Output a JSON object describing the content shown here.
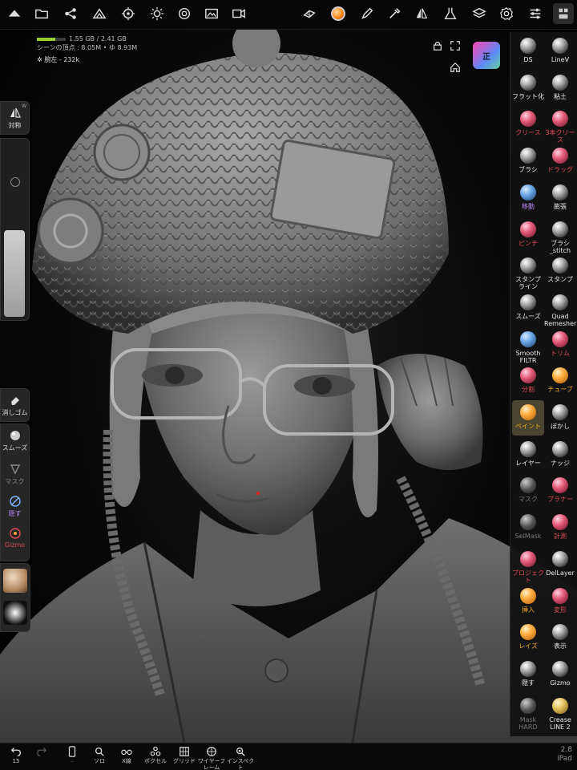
{
  "app": {
    "version": "2.8",
    "device": "iPad"
  },
  "stats": {
    "memory_label": "1.55 GB / 2.41 GB",
    "memory_fraction": 0.64,
    "vertex_label": "シーンの頂点 : 8.05M • ",
    "vertex_suffix": "ゆ 8.93M",
    "object_label": "腕左 - 232k"
  },
  "view": {
    "orientation_label": "正"
  },
  "left_panel": {
    "symmetry": {
      "label": "対称",
      "badge": "W"
    },
    "eraser": "消しゴム",
    "smooth": "スムーズ",
    "mask": "マスク",
    "hide": "隠す",
    "gizmo": "Gizmo"
  },
  "tools": [
    {
      "label": "DS",
      "style": "white",
      "icon": "ds-brush-icon"
    },
    {
      "label": "LineV",
      "style": "white",
      "icon": "linev-brush-icon"
    },
    {
      "label": "フラット化",
      "style": "white",
      "icon": "flatten-icon"
    },
    {
      "label": "粘土",
      "style": "white",
      "icon": "clay-icon"
    },
    {
      "label": "クリース",
      "style": "red",
      "icon": "crease-icon"
    },
    {
      "label": "3本クリース",
      "style": "red",
      "icon": "crease3-icon"
    },
    {
      "label": "ブラシ",
      "style": "white",
      "icon": "brush-icon"
    },
    {
      "label": "ドラッグ",
      "style": "red",
      "icon": "drag-icon"
    },
    {
      "label": "移動",
      "style": "purple",
      "icon": "move-icon"
    },
    {
      "label": "膨張",
      "style": "white",
      "icon": "inflate-icon"
    },
    {
      "label": "ピンチ",
      "style": "red",
      "icon": "pinch-icon"
    },
    {
      "label": "ブラシ_stitch",
      "style": "white",
      "icon": "stitch-brush-icon"
    },
    {
      "label": "スタンプ ライン",
      "style": "white",
      "icon": "stamp-line-icon"
    },
    {
      "label": "スタンプ",
      "style": "white",
      "icon": "stamp-icon"
    },
    {
      "label": "スムーズ",
      "style": "white",
      "icon": "smooth-icon"
    },
    {
      "label": "Quad Remesher",
      "style": "white",
      "icon": "quad-remesher-icon"
    },
    {
      "label": "Smooth FILTR",
      "style": "white",
      "icon": "smooth-filter-icon"
    },
    {
      "label": "トリム",
      "style": "red",
      "icon": "trim-icon"
    },
    {
      "label": "分割",
      "style": "red",
      "icon": "split-icon"
    },
    {
      "label": "チューブ",
      "style": "orange",
      "icon": "tube-icon"
    },
    {
      "label": "ペイント",
      "style": "orange",
      "icon": "paint-icon",
      "selected": true
    },
    {
      "label": "ぼかし",
      "style": "white",
      "icon": "blur-icon"
    },
    {
      "label": "レイヤー",
      "style": "white",
      "icon": "layer-icon"
    },
    {
      "label": "ナッジ",
      "style": "white",
      "icon": "nudge-icon"
    },
    {
      "label": "マスク",
      "style": "gray",
      "icon": "mask-icon"
    },
    {
      "label": "プラナー",
      "style": "red",
      "icon": "planar-icon"
    },
    {
      "label": "SelMask",
      "style": "gray",
      "icon": "selmask-icon"
    },
    {
      "label": "計測",
      "style": "red",
      "icon": "measure-icon"
    },
    {
      "label": "プロジェクト",
      "style": "red",
      "icon": "project-icon"
    },
    {
      "label": "DelLayer",
      "style": "white",
      "icon": "dellayer-icon"
    },
    {
      "label": "挿入",
      "style": "orange",
      "icon": "insert-icon"
    },
    {
      "label": "変形",
      "style": "red",
      "icon": "transform-icon"
    },
    {
      "label": "レイズ",
      "style": "orange",
      "icon": "raise-icon"
    },
    {
      "label": "表示",
      "style": "white",
      "icon": "camera-icon"
    },
    {
      "label": "隠す",
      "style": "white",
      "icon": "hide-icon"
    },
    {
      "label": "Gizmo",
      "style": "white",
      "icon": "gizmo-icon"
    },
    {
      "label": "Mask HARD",
      "style": "gray",
      "icon": "mask-hard-icon"
    },
    {
      "label": "Crease LINE 2",
      "style": "white",
      "icon": "crease-line2-icon"
    }
  ],
  "bottom_bar": {
    "undo_count": "15",
    "items": [
      {
        "label": "ソロ",
        "icon": "search-icon"
      },
      {
        "label": "X線",
        "icon": "xray-glasses-icon"
      },
      {
        "label": "ボクセル",
        "icon": "voxel-icon"
      },
      {
        "label": "グリッド",
        "icon": "grid-icon"
      },
      {
        "label": "ワイヤーフレーム",
        "icon": "wireframe-icon"
      },
      {
        "label": "インスペクト",
        "icon": "inspect-icon"
      }
    ]
  }
}
